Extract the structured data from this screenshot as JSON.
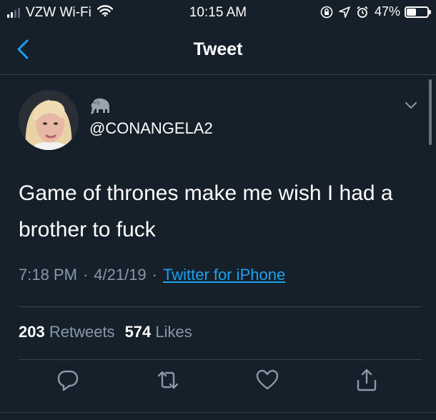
{
  "status_bar": {
    "carrier": "VZW Wi-Fi",
    "time": "10:15 AM",
    "battery_percent": "47%",
    "battery_level": 0.47,
    "signal_bars_filled": 2,
    "signal_bars_total": 4
  },
  "nav": {
    "title": "Tweet",
    "back_icon": "chevron-left-icon"
  },
  "tweet": {
    "display_name_icon": "elephant-icon",
    "handle": "@CONANGELA2",
    "text": "Game of thrones make me wish I had a brother to fuck",
    "time": "7:18 PM",
    "date": "4/21/19",
    "source": "Twitter for iPhone",
    "separator": "·",
    "retweets_count": "203",
    "retweets_label": "Retweets",
    "likes_count": "574",
    "likes_label": "Likes"
  },
  "actions": [
    "reply-icon",
    "retweet-icon",
    "like-icon",
    "share-icon"
  ],
  "colors": {
    "background": "#15202b",
    "text": "#ffffff",
    "muted": "#8899a6",
    "link": "#1da1f2",
    "divider": "#38444d"
  }
}
